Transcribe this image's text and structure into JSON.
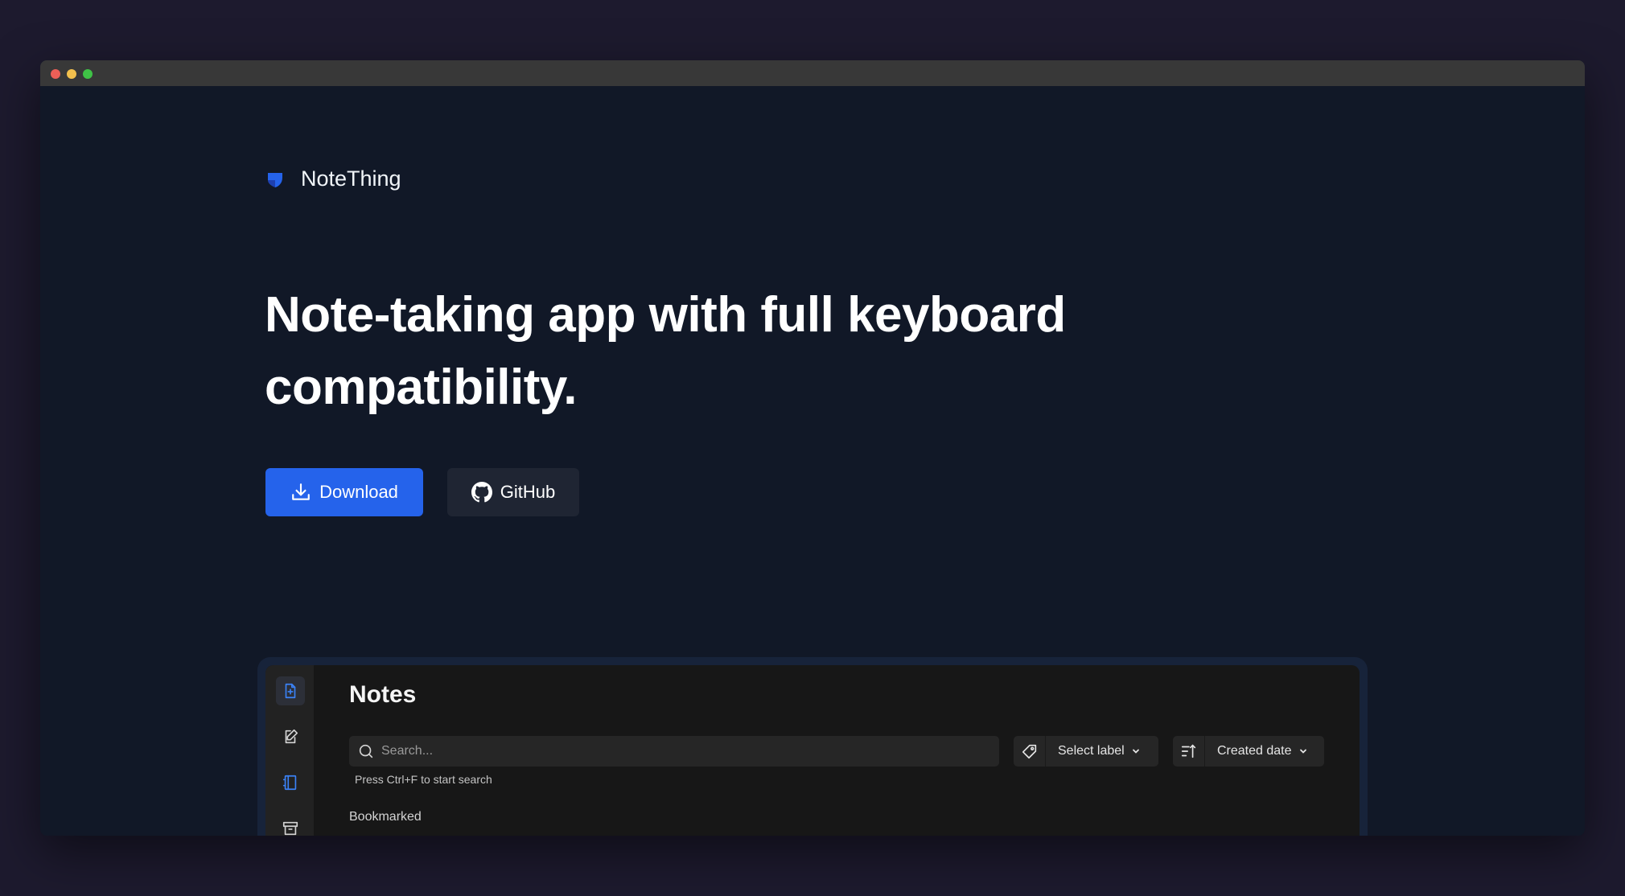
{
  "brand": {
    "name": "NoteThing",
    "accent": "#2563eb"
  },
  "hero": {
    "title_line1": "Note-taking app with full keyboard",
    "title_line2": "compatibility."
  },
  "actions": {
    "download_label": "Download",
    "github_label": "GitHub"
  },
  "app_preview": {
    "title": "Notes",
    "sidebar": [
      "new-note-icon",
      "edit-note-icon",
      "notebook-icon",
      "archive-icon"
    ],
    "search": {
      "placeholder": "Search...",
      "hint": "Press Ctrl+F to start search"
    },
    "label_filter": {
      "value": "Select label"
    },
    "sort": {
      "value": "Created date"
    },
    "section": "Bookmarked"
  }
}
